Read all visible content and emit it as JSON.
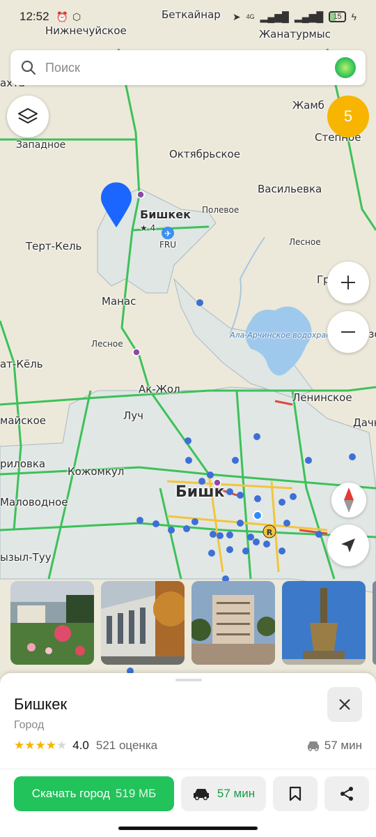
{
  "status_bar": {
    "time": "12:52",
    "battery": "15",
    "network": "4G"
  },
  "search": {
    "placeholder": "Поиск"
  },
  "traffic": {
    "level": "5"
  },
  "map": {
    "places": [
      {
        "id": "betkainar",
        "label": "Беткайнар"
      },
      {
        "id": "nizhnechuyskoe",
        "label": "Нижнечуйское"
      },
      {
        "id": "zhanaturmys",
        "label": "Жанатурмыс"
      },
      {
        "id": "akhta",
        "label": "ахта"
      },
      {
        "id": "zhamb",
        "label": "Жамб"
      },
      {
        "id": "stepnoe",
        "label": "Степное"
      },
      {
        "id": "zapadnoe",
        "label": "Западное"
      },
      {
        "id": "oktyabrskoe",
        "label": "Октябрьское"
      },
      {
        "id": "vasilevka",
        "label": "Васильевка"
      },
      {
        "id": "bishkek_airport",
        "label": "Бишкек"
      },
      {
        "id": "polevoe",
        "label": "Полевое"
      },
      {
        "id": "tert_kel",
        "label": "Терт-Кель"
      },
      {
        "id": "fru",
        "label": "FRU"
      },
      {
        "id": "lesnoe1",
        "label": "Лесное"
      },
      {
        "id": "gra",
        "label": "Гра"
      },
      {
        "id": "manas",
        "label": "Манас"
      },
      {
        "id": "lesnoe2",
        "label": "Лесное"
      },
      {
        "id": "kuvo",
        "label": "Кузо"
      },
      {
        "id": "chat_kel",
        "label": "ат-Кёль"
      },
      {
        "id": "ak_zhol",
        "label": "Ак-Жол"
      },
      {
        "id": "leninskoe",
        "label": "Ленинское"
      },
      {
        "id": "luch",
        "label": "Луч"
      },
      {
        "id": "maiskoe",
        "label": "майское"
      },
      {
        "id": "dacha",
        "label": "Дачн"
      },
      {
        "id": "rilovka",
        "label": "риловка"
      },
      {
        "id": "kozhomkul",
        "label": "Кожомкул"
      },
      {
        "id": "malovodnoe",
        "label": "Маловодное"
      },
      {
        "id": "bishkek_city",
        "label": "Бишк"
      },
      {
        "id": "kyzyl_tuu",
        "label": "ызыл-Туу"
      }
    ],
    "reservoir_label": "Ала-Арчинское водохранилище",
    "airport_rating": "★ 4"
  },
  "sheet": {
    "title": "Бишкек",
    "subtitle": "Город",
    "rating_value": "4.0",
    "rating_stars": 4,
    "rating_count": "521 оценка",
    "eta": "57 мин",
    "download_label": "Скачать город",
    "download_size": "519 МБ",
    "route_eta": "57 мин"
  },
  "colors": {
    "accent": "#21c35a",
    "traffic": "#f7b500",
    "pin": "#1a66ff"
  }
}
